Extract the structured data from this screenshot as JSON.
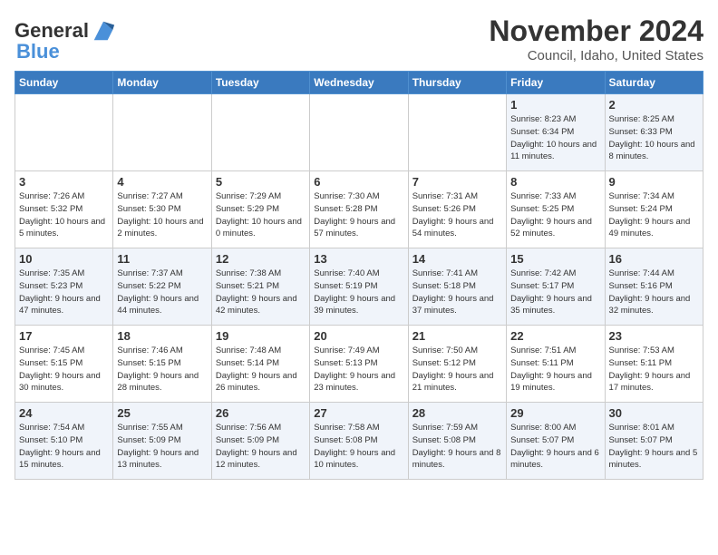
{
  "header": {
    "logo_line1": "General",
    "logo_line2": "Blue",
    "month": "November 2024",
    "location": "Council, Idaho, United States"
  },
  "days_of_week": [
    "Sunday",
    "Monday",
    "Tuesday",
    "Wednesday",
    "Thursday",
    "Friday",
    "Saturday"
  ],
  "weeks": [
    [
      {
        "day": "",
        "info": ""
      },
      {
        "day": "",
        "info": ""
      },
      {
        "day": "",
        "info": ""
      },
      {
        "day": "",
        "info": ""
      },
      {
        "day": "",
        "info": ""
      },
      {
        "day": "1",
        "info": "Sunrise: 8:23 AM\nSunset: 6:34 PM\nDaylight: 10 hours and 11 minutes."
      },
      {
        "day": "2",
        "info": "Sunrise: 8:25 AM\nSunset: 6:33 PM\nDaylight: 10 hours and 8 minutes."
      }
    ],
    [
      {
        "day": "3",
        "info": "Sunrise: 7:26 AM\nSunset: 5:32 PM\nDaylight: 10 hours and 5 minutes."
      },
      {
        "day": "4",
        "info": "Sunrise: 7:27 AM\nSunset: 5:30 PM\nDaylight: 10 hours and 2 minutes."
      },
      {
        "day": "5",
        "info": "Sunrise: 7:29 AM\nSunset: 5:29 PM\nDaylight: 10 hours and 0 minutes."
      },
      {
        "day": "6",
        "info": "Sunrise: 7:30 AM\nSunset: 5:28 PM\nDaylight: 9 hours and 57 minutes."
      },
      {
        "day": "7",
        "info": "Sunrise: 7:31 AM\nSunset: 5:26 PM\nDaylight: 9 hours and 54 minutes."
      },
      {
        "day": "8",
        "info": "Sunrise: 7:33 AM\nSunset: 5:25 PM\nDaylight: 9 hours and 52 minutes."
      },
      {
        "day": "9",
        "info": "Sunrise: 7:34 AM\nSunset: 5:24 PM\nDaylight: 9 hours and 49 minutes."
      }
    ],
    [
      {
        "day": "10",
        "info": "Sunrise: 7:35 AM\nSunset: 5:23 PM\nDaylight: 9 hours and 47 minutes."
      },
      {
        "day": "11",
        "info": "Sunrise: 7:37 AM\nSunset: 5:22 PM\nDaylight: 9 hours and 44 minutes."
      },
      {
        "day": "12",
        "info": "Sunrise: 7:38 AM\nSunset: 5:21 PM\nDaylight: 9 hours and 42 minutes."
      },
      {
        "day": "13",
        "info": "Sunrise: 7:40 AM\nSunset: 5:19 PM\nDaylight: 9 hours and 39 minutes."
      },
      {
        "day": "14",
        "info": "Sunrise: 7:41 AM\nSunset: 5:18 PM\nDaylight: 9 hours and 37 minutes."
      },
      {
        "day": "15",
        "info": "Sunrise: 7:42 AM\nSunset: 5:17 PM\nDaylight: 9 hours and 35 minutes."
      },
      {
        "day": "16",
        "info": "Sunrise: 7:44 AM\nSunset: 5:16 PM\nDaylight: 9 hours and 32 minutes."
      }
    ],
    [
      {
        "day": "17",
        "info": "Sunrise: 7:45 AM\nSunset: 5:15 PM\nDaylight: 9 hours and 30 minutes."
      },
      {
        "day": "18",
        "info": "Sunrise: 7:46 AM\nSunset: 5:15 PM\nDaylight: 9 hours and 28 minutes."
      },
      {
        "day": "19",
        "info": "Sunrise: 7:48 AM\nSunset: 5:14 PM\nDaylight: 9 hours and 26 minutes."
      },
      {
        "day": "20",
        "info": "Sunrise: 7:49 AM\nSunset: 5:13 PM\nDaylight: 9 hours and 23 minutes."
      },
      {
        "day": "21",
        "info": "Sunrise: 7:50 AM\nSunset: 5:12 PM\nDaylight: 9 hours and 21 minutes."
      },
      {
        "day": "22",
        "info": "Sunrise: 7:51 AM\nSunset: 5:11 PM\nDaylight: 9 hours and 19 minutes."
      },
      {
        "day": "23",
        "info": "Sunrise: 7:53 AM\nSunset: 5:11 PM\nDaylight: 9 hours and 17 minutes."
      }
    ],
    [
      {
        "day": "24",
        "info": "Sunrise: 7:54 AM\nSunset: 5:10 PM\nDaylight: 9 hours and 15 minutes."
      },
      {
        "day": "25",
        "info": "Sunrise: 7:55 AM\nSunset: 5:09 PM\nDaylight: 9 hours and 13 minutes."
      },
      {
        "day": "26",
        "info": "Sunrise: 7:56 AM\nSunset: 5:09 PM\nDaylight: 9 hours and 12 minutes."
      },
      {
        "day": "27",
        "info": "Sunrise: 7:58 AM\nSunset: 5:08 PM\nDaylight: 9 hours and 10 minutes."
      },
      {
        "day": "28",
        "info": "Sunrise: 7:59 AM\nSunset: 5:08 PM\nDaylight: 9 hours and 8 minutes."
      },
      {
        "day": "29",
        "info": "Sunrise: 8:00 AM\nSunset: 5:07 PM\nDaylight: 9 hours and 6 minutes."
      },
      {
        "day": "30",
        "info": "Sunrise: 8:01 AM\nSunset: 5:07 PM\nDaylight: 9 hours and 5 minutes."
      }
    ]
  ]
}
